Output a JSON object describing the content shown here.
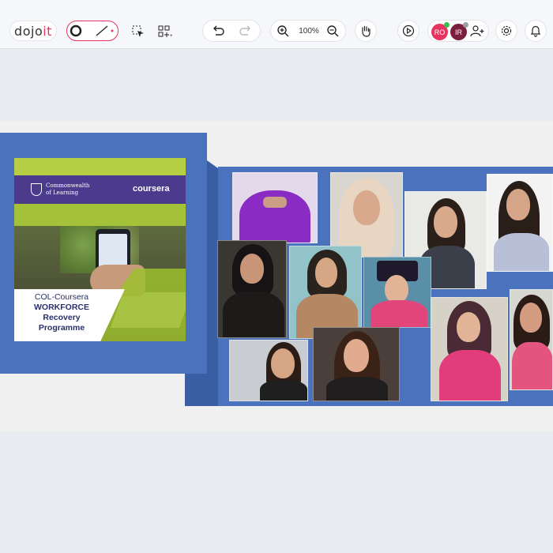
{
  "app": {
    "logo_prefix": "dojo",
    "logo_suffix": "it"
  },
  "toolbar": {
    "zoom_level": "100%",
    "icons": [
      "circle-tool-icon",
      "line-tool-icon",
      "select-cursor-icon",
      "add-component-icon",
      "undo-icon",
      "redo-icon",
      "zoom-in-icon",
      "zoom-out-icon",
      "hand-pan-icon",
      "play-icon",
      "add-user-icon",
      "settings-gear-icon",
      "notification-bell-icon"
    ]
  },
  "collaborators": [
    {
      "initials": "RO",
      "color": "#e6335f",
      "dot": "#3cba54"
    },
    {
      "initials": "IR",
      "color": "#7a1f3d",
      "dot": "#9aa0a6"
    }
  ],
  "card": {
    "org_line1": "Commonwealth",
    "org_line2": "of Learning",
    "partner": "coursera",
    "title_line1": "COL-Coursera",
    "title_line2": "WORKFORCE",
    "title_line3": "Recovery",
    "title_line4": "Programme"
  },
  "colors": {
    "board_blue": "#4a72bd",
    "accent": "#e6335f",
    "card_green": "#a3c23a",
    "card_purple": "#4b3b8c"
  }
}
